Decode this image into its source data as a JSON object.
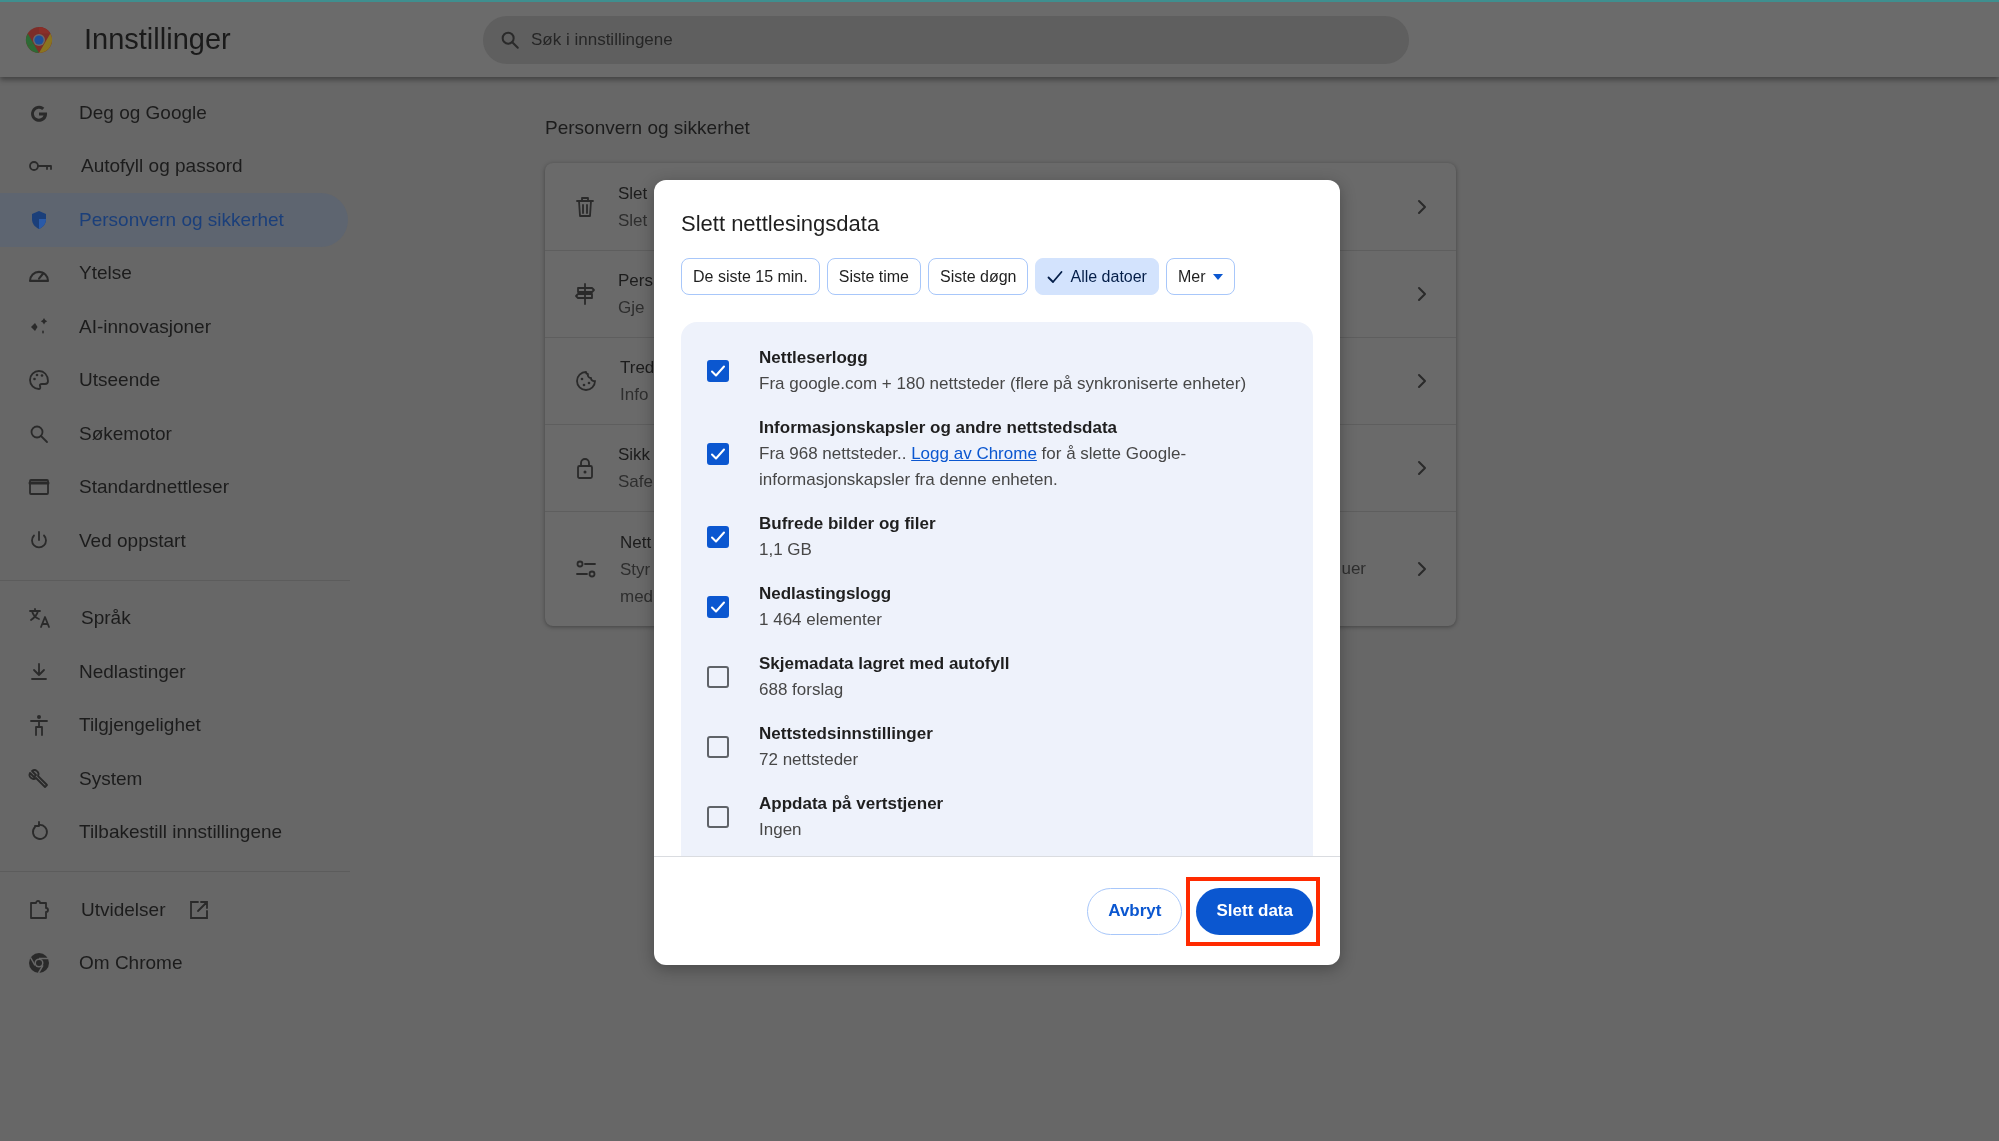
{
  "header": {
    "title": "Innstillinger",
    "search": {
      "placeholder": "Søk i innstillingene"
    }
  },
  "sidebar": {
    "groups": [
      {
        "items": [
          {
            "label": "Deg og Google",
            "selected": false,
            "external": false
          },
          {
            "label": "Autofyll og passord",
            "selected": false,
            "external": false
          },
          {
            "label": "Personvern og sikkerhet",
            "selected": true,
            "external": false
          },
          {
            "label": "Ytelse",
            "selected": false,
            "external": false
          },
          {
            "label": "AI-innovasjoner",
            "selected": false,
            "external": false
          },
          {
            "label": "Utseende",
            "selected": false,
            "external": false
          },
          {
            "label": "Søkemotor",
            "selected": false,
            "external": false
          },
          {
            "label": "Standardnettleser",
            "selected": false,
            "external": false
          },
          {
            "label": "Ved oppstart",
            "selected": false,
            "external": false
          }
        ]
      },
      {
        "items": [
          {
            "label": "Språk",
            "selected": false,
            "external": false
          },
          {
            "label": "Nedlastinger",
            "selected": false,
            "external": false
          },
          {
            "label": "Tilgjengelighet",
            "selected": false,
            "external": false
          },
          {
            "label": "System",
            "selected": false,
            "external": false
          },
          {
            "label": "Tilbakestill innstillingene",
            "selected": false,
            "external": false
          }
        ]
      },
      {
        "items": [
          {
            "label": "Utvidelser",
            "selected": false,
            "external": true
          },
          {
            "label": "Om Chrome",
            "selected": false,
            "external": false
          }
        ]
      }
    ]
  },
  "page": {
    "section_title": "Personvern og sikkerhet",
    "rows": [
      {
        "title": "Slet",
        "lines": [
          "Slet"
        ]
      },
      {
        "title": "Pers",
        "lines": [
          "Gje"
        ]
      },
      {
        "title": "Tred",
        "lines": [
          "Info"
        ]
      },
      {
        "title": "Sikk",
        "lines": [
          "Safe"
        ]
      },
      {
        "title": "Nett",
        "lines": [
          "Styr",
          "med"
        ],
        "trailing": "uer"
      }
    ]
  },
  "dialog": {
    "title": "Slett nettlesingsdata",
    "time_ranges": [
      {
        "label": "De siste 15 min.",
        "selected": false
      },
      {
        "label": "Siste time",
        "selected": false
      },
      {
        "label": "Siste døgn",
        "selected": false
      },
      {
        "label": "Alle datoer",
        "selected": true
      }
    ],
    "more": {
      "label": "Mer"
    },
    "items": [
      {
        "title": "Nettleserlogg",
        "detail": "Fra google.com + 180 nettsteder (flere på synkroniserte enheter)",
        "checked": true
      },
      {
        "title": "Informasjonskapsler og andre nettstedsdata",
        "detail": "Fra 968 nettsteder.. ",
        "link": "Logg av Chrome",
        "detail_after": " for å slette Google-informasjonskapsler fra denne enheten.",
        "checked": true
      },
      {
        "title": "Bufrede bilder og filer",
        "detail": "1,1 GB",
        "checked": true
      },
      {
        "title": "Nedlastingslogg",
        "detail": "1 464 elementer",
        "checked": true
      },
      {
        "title": "Skjemadata lagret med autofyll",
        "detail": "688 forslag",
        "checked": false
      },
      {
        "title": "Nettstedsinnstillinger",
        "detail": "72 nettsteder",
        "checked": false
      },
      {
        "title": "Appdata på vertstjener",
        "detail": "Ingen",
        "checked": false
      }
    ],
    "buttons": [
      {
        "label": "Avbryt",
        "kind": "secondary",
        "highlighted": false
      },
      {
        "label": "Slett data",
        "kind": "primary",
        "highlighted": true
      }
    ]
  }
}
